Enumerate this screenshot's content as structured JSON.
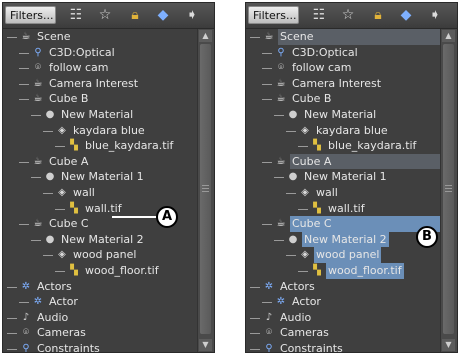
{
  "toolbar": {
    "filters_label": "Filters..."
  },
  "tree": [
    {
      "label": "Scene",
      "icon": "scene-icon",
      "depth": 0
    },
    {
      "label": "C3D:Optical",
      "icon": "optical-icon",
      "depth": 1
    },
    {
      "label": "follow cam",
      "icon": "camera-icon",
      "depth": 1
    },
    {
      "label": "Camera Interest",
      "icon": "interest-icon",
      "depth": 1
    },
    {
      "label": "Cube B",
      "icon": "model-icon",
      "depth": 1
    },
    {
      "label": "New Material",
      "icon": "material-icon",
      "depth": 2
    },
    {
      "label": "kaydara blue",
      "icon": "texture-icon",
      "depth": 3
    },
    {
      "label": "blue_kaydara.tif",
      "icon": "image-icon",
      "depth": 4
    },
    {
      "label": "Cube A",
      "icon": "model-icon",
      "depth": 1
    },
    {
      "label": "New Material 1",
      "icon": "material-icon",
      "depth": 2
    },
    {
      "label": "wall",
      "icon": "texture-icon",
      "depth": 3
    },
    {
      "label": "wall.tif",
      "icon": "image-icon",
      "depth": 4
    },
    {
      "label": "Cube C",
      "icon": "model-icon",
      "depth": 1
    },
    {
      "label": "New Material 2",
      "icon": "material-icon",
      "depth": 2
    },
    {
      "label": "wood panel",
      "icon": "texture-icon",
      "depth": 3
    },
    {
      "label": "wood_floor.tif",
      "icon": "image-icon",
      "depth": 4
    },
    {
      "label": "Actors",
      "icon": "actors-icon",
      "depth": 0
    },
    {
      "label": "Actor",
      "icon": "actor-icon",
      "depth": 1
    },
    {
      "label": "Audio",
      "icon": "audio-icon",
      "depth": 0
    },
    {
      "label": "Cameras",
      "icon": "cameras-icon",
      "depth": 0
    },
    {
      "label": "Constraints",
      "icon": "constraints-icon",
      "depth": 0
    }
  ],
  "callouts": {
    "a": "A",
    "b": "B"
  },
  "panel_b_highlight": {
    "grey_rows": [
      "Scene",
      "Cube A"
    ],
    "blue_rows": [
      "Cube C",
      "New Material 2",
      "wood panel",
      "wood_floor.tif"
    ]
  },
  "colors": {
    "panel_bg": "#3f3f3f",
    "selection_blue": "#6b8fb8",
    "selection_grey": "#5a5f66",
    "text": "#e6e6e6"
  }
}
